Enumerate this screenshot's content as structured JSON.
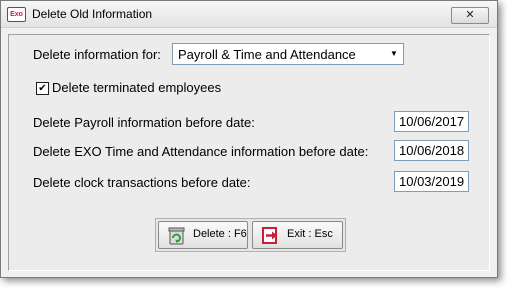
{
  "window": {
    "title": "Delete Old Information",
    "app_icon_text": "Exo",
    "close_glyph": "✕"
  },
  "form": {
    "delete_for_label": "Delete information for:",
    "delete_for_value": "Payroll & Time and Attendance",
    "dropdown_arrow": "▼",
    "terminated_label": "Delete terminated employees",
    "terminated_checked": true,
    "check_glyph": "✔",
    "rows": [
      {
        "label": "Delete Payroll information before date:",
        "value": "10/06/2017"
      },
      {
        "label": "Delete EXO Time and Attendance information before date:",
        "value": "10/06/2018"
      },
      {
        "label": "Delete clock transactions before date:",
        "value": "10/03/2019"
      }
    ]
  },
  "buttons": {
    "delete_label": "Delete : F6",
    "exit_label": "Exit : Esc"
  },
  "colors": {
    "accent_red": "#c81e3c",
    "delete_icon_green": "#2e9d3a"
  }
}
